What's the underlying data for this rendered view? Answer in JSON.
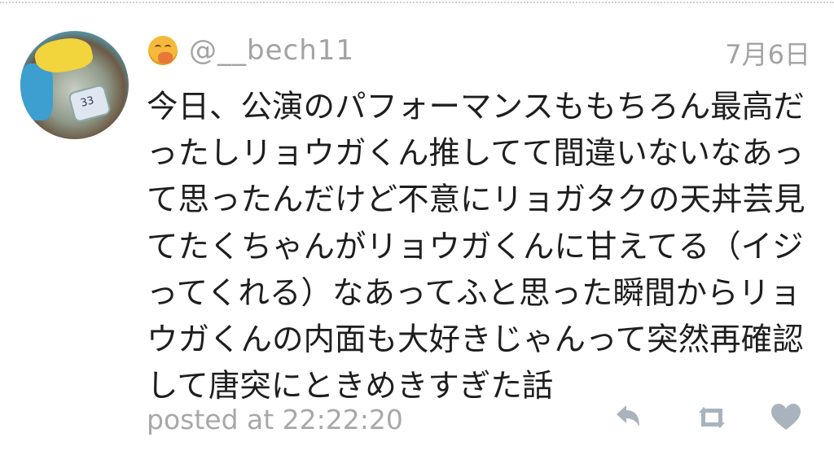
{
  "post": {
    "username": "@__bech11",
    "date": "7月6日",
    "text": "今日、公演のパフォーマンスももちろん最高だったしリョウガくん推してて間違いないなあって思ったんだけど不意にリョガタクの天丼芸見てたくちゃんがリョウガくんに甘えてる（イジってくれる）なあってふと思った瞬間からリョウガくんの内面も大好きじゃんって突然再確認して唐突にときめきすぎた話",
    "posted_label": "posted at 22:22:20"
  },
  "icons": {
    "avatar": "user-avatar-photo",
    "emoji": "face-with-hand-over-mouth-emoji",
    "reply": "reply-icon",
    "retweet": "retweet-icon",
    "like": "heart-icon"
  },
  "colors": {
    "meta_text": "#a3a3a3",
    "body_text": "#1e1e1e",
    "icon": "#a9b3bd"
  }
}
